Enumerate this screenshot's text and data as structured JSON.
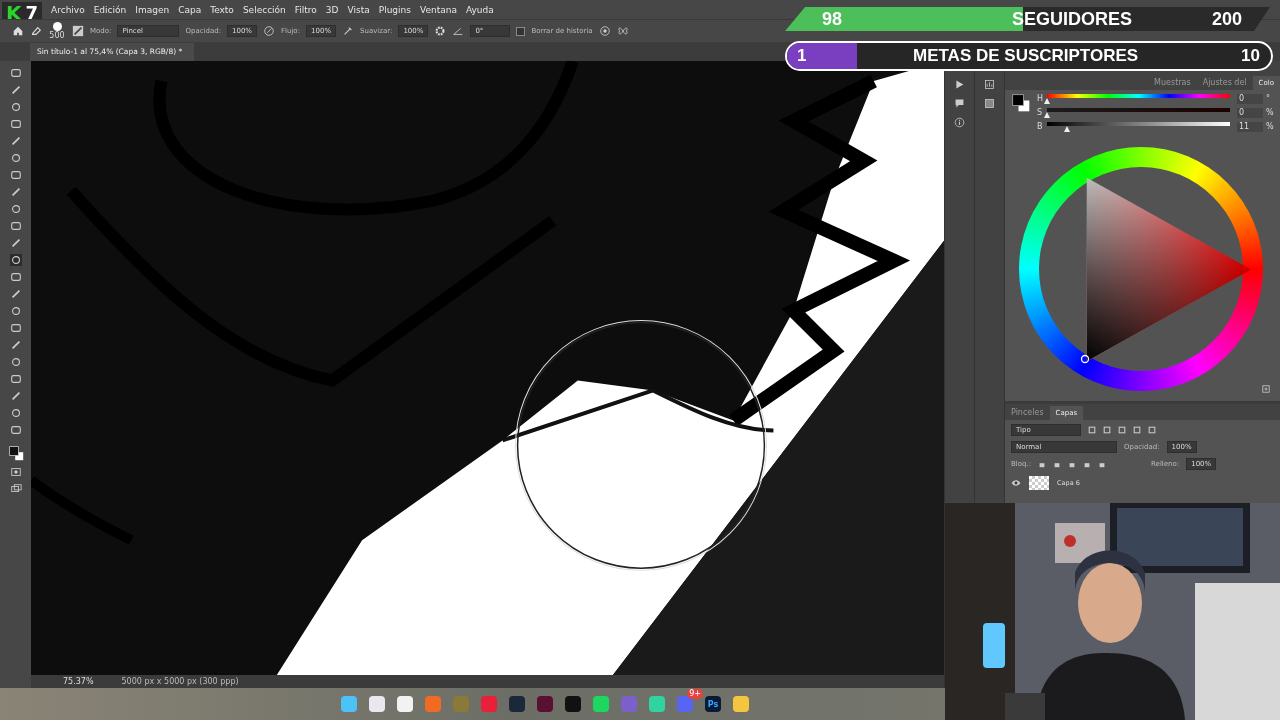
{
  "menu": [
    "Archivo",
    "Edición",
    "Imagen",
    "Capa",
    "Texto",
    "Selección",
    "Filtro",
    "3D",
    "Vista",
    "Plugins",
    "Ventana",
    "Ayuda"
  ],
  "options_bar": {
    "brush_size": "500",
    "mode_label": "Modo:",
    "mode": "Pincel",
    "opacity_label": "Opacidad:",
    "opacity": "100%",
    "flow_label": "Flujo:",
    "flow": "100%",
    "smoothing_label": "Suavizar:",
    "smoothing": "100%",
    "angle": "0°",
    "erase_history": {
      "label": "Borrar de historia",
      "checked": false
    }
  },
  "document_tab": {
    "title": "Sin título-1 al 75,4% (Capa 3, RGB/8) *"
  },
  "status_bar": {
    "zoom": "75.37%",
    "size": "5000 px x 5000 px (300 ppp)"
  },
  "color_panel": {
    "tabs": [
      {
        "label": "Muestras",
        "selected": false
      },
      {
        "label": "Ajustes del",
        "selected": false
      },
      {
        "label": "Colo",
        "selected": true
      }
    ],
    "sliders": [
      {
        "label": "H",
        "value": "0",
        "unit": "°",
        "level": 0
      },
      {
        "label": "S",
        "value": "0",
        "unit": "%",
        "level": 0
      },
      {
        "label": "B",
        "value": "11",
        "unit": "%",
        "level": 0.11
      }
    ]
  },
  "layers_panel": {
    "tabs": [
      {
        "label": "Pinceles",
        "selected": false
      },
      {
        "label": "Capas",
        "selected": true
      }
    ],
    "filter": "Tipo",
    "blend_mode": "Normal",
    "opacity_label": "Opacidad:",
    "opacity": "100%",
    "lock_label": "Bloq.:",
    "fill_label": "Relleno:",
    "fill": "100%",
    "layers": [
      {
        "name": "Capa 6",
        "visible": true
      }
    ]
  },
  "stream_overlay": {
    "logo": "K",
    "logo_number": "7",
    "followers": {
      "current": "98",
      "label": "SEGUIDORES",
      "goal": "200",
      "level": 0.49
    },
    "subscribers": {
      "current": "1",
      "label": "METAS DE SUSCRIPTORES",
      "goal": "10",
      "level": 0.1
    }
  },
  "taskbar": {
    "discord_badge": "9+",
    "photoshop_label": "Ps"
  }
}
